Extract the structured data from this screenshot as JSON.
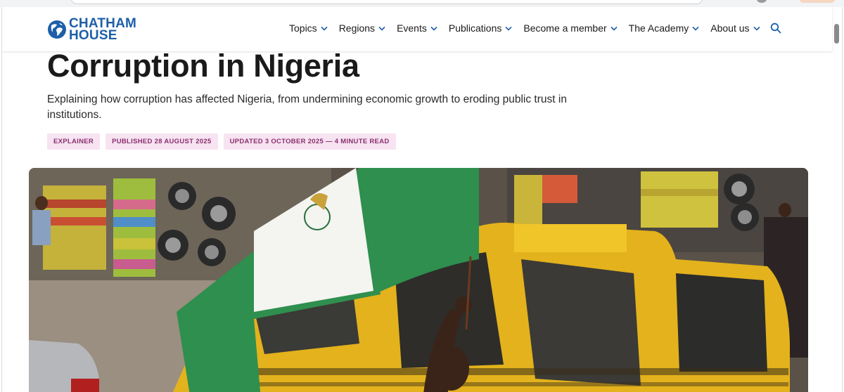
{
  "site": {
    "logo_line1": "CHATHAM",
    "logo_line2": "HOUSE"
  },
  "nav": {
    "items": [
      {
        "label": "Topics"
      },
      {
        "label": "Regions"
      },
      {
        "label": "Events"
      },
      {
        "label": "Publications"
      },
      {
        "label": "Become a member"
      },
      {
        "label": "The Academy"
      },
      {
        "label": "About us"
      }
    ],
    "search_icon": "search-icon"
  },
  "article": {
    "title": "Corruption in Nigeria",
    "standfirst": "Explaining how corruption has affected Nigeria, from undermining economic growth to eroding public trust in institutions.",
    "tags": [
      "EXPLAINER",
      "PUBLISHED 28 AUGUST 2025",
      "UPDATED 3 OCTOBER 2025 — 4 MINUTE READ"
    ]
  },
  "colors": {
    "brand_blue": "#1d5fa8",
    "tag_bg": "#f7e3f1",
    "tag_text": "#8a2f6f",
    "flag_green": "#2f8f4e",
    "taxi_yellow": "#e3b21c"
  }
}
